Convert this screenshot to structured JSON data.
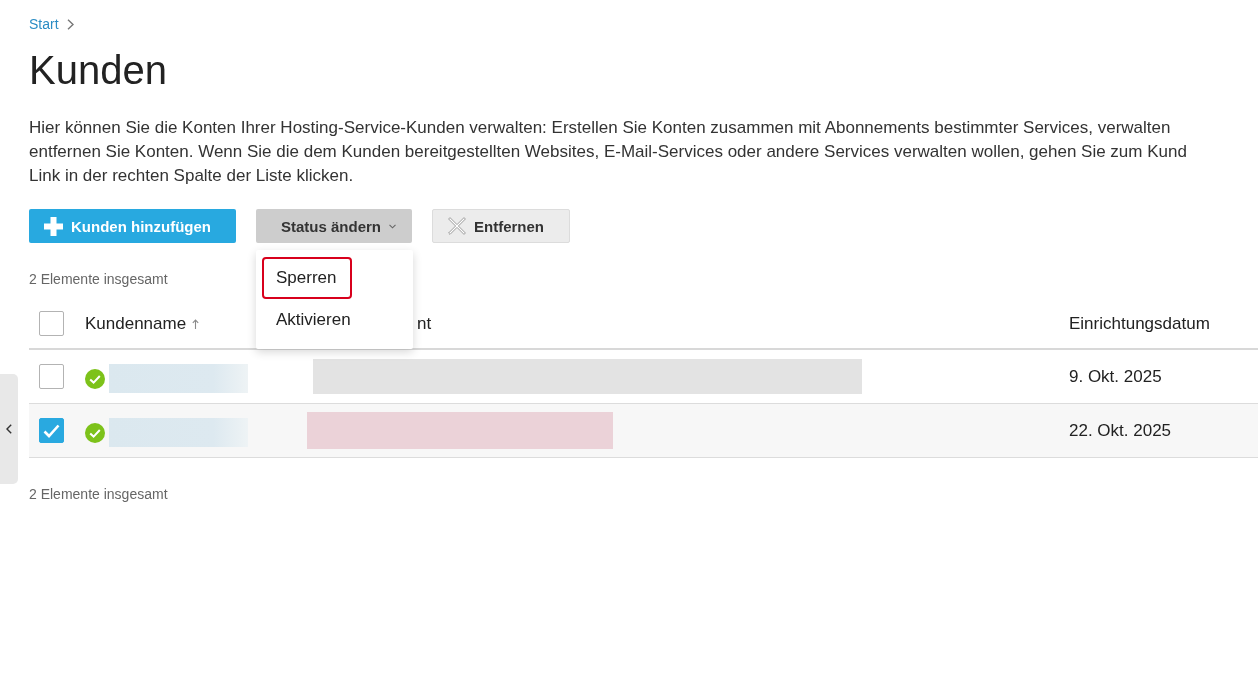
{
  "breadcrumb": [
    {
      "label": "Start"
    }
  ],
  "title": "Kunden",
  "description_lines": [
    "Hier können Sie die Konten Ihrer Hosting-Service-Kunden verwalten: Erstellen Sie Konten zusammen mit Abonnements bestimmter Services, verwalten",
    "entfernen Sie Konten. Wenn Sie die dem Kunden bereitgestellten Websites, E-Mail-Services oder andere Services verwalten wollen, gehen Sie zum Kund",
    "Link in der rechten Spalte der Liste klicken."
  ],
  "toolbar": {
    "buttons": [
      {
        "kind": "primary",
        "label": "Kunden hinzufügen"
      },
      {
        "kind": "dropdown",
        "label": "Status ändern",
        "expanded": true,
        "menu": [
          {
            "label": "Sperren",
            "highlighted": true
          },
          {
            "label": "Aktivieren",
            "highlighted": false
          }
        ]
      },
      {
        "kind": "secondary",
        "label": "Entfernen"
      }
    ]
  },
  "count_top": "2 Elemente insgesamt",
  "table": {
    "select_all": {
      "checked": false
    },
    "columns": [
      {
        "label": "Kundenname",
        "sorted": true
      },
      {
        "label": "nt",
        "sorted": false
      },
      {
        "label": "Einrichtungsdatum",
        "sorted": false
      }
    ],
    "rows": [
      {
        "selected": false,
        "active": true,
        "color": "#e3e3e3",
        "date": "9. Okt. 2025"
      },
      {
        "selected": true,
        "active": true,
        "color": "#ebd2d8",
        "date": "22. Okt. 2025"
      }
    ]
  },
  "count_bottom": "2 Elemente insgesamt"
}
